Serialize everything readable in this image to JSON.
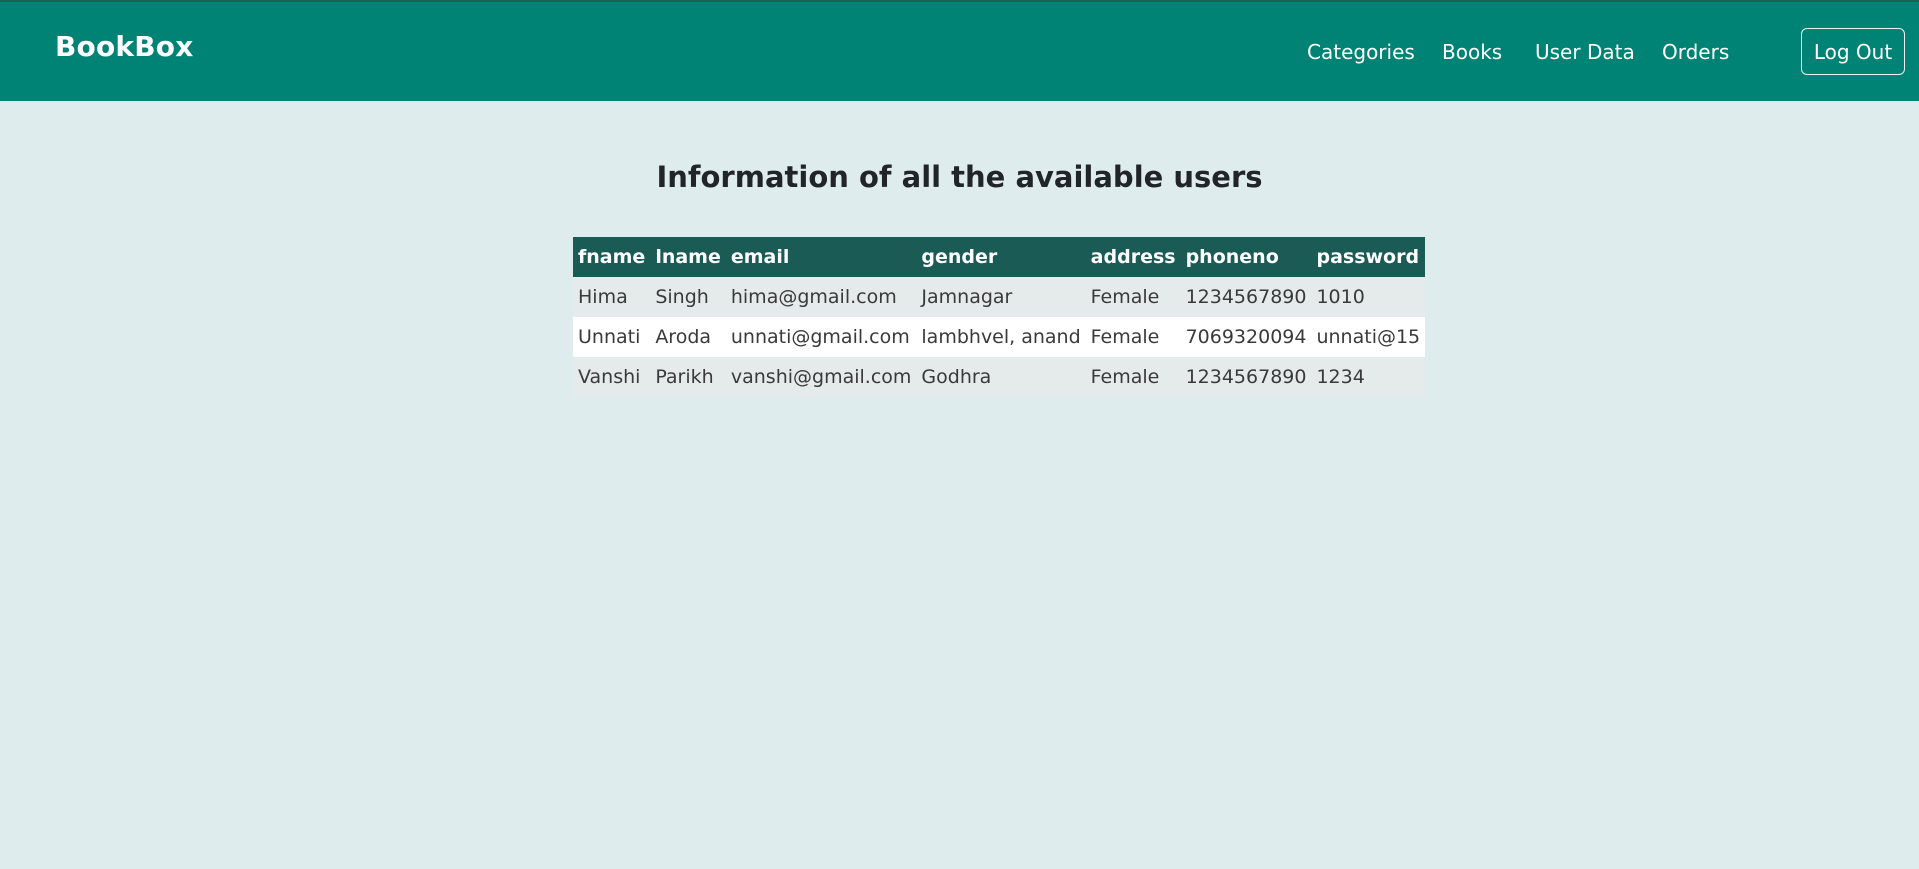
{
  "header": {
    "brand": "BookBox",
    "nav": [
      "Categories",
      "Books",
      "User Data",
      "Orders"
    ],
    "logout_label": "Log Out"
  },
  "main": {
    "title": "Information of all the available users",
    "table": {
      "columns": [
        "fname",
        "lname",
        "email",
        "gender",
        "address",
        "phoneno",
        "password"
      ],
      "rows": [
        [
          "Hima",
          "Singh",
          "hima@gmail.com",
          "Jamnagar",
          "Female",
          "1234567890",
          "1010"
        ],
        [
          "Unnati",
          "Aroda",
          "unnati@gmail.com",
          "lambhvel, anand",
          "Female",
          "7069320094",
          "unnati@15"
        ],
        [
          "Vanshi",
          "Parikh",
          "vanshi@gmail.com",
          "Godhra",
          "Female",
          "1234567890",
          "1234"
        ]
      ]
    }
  },
  "colors": {
    "navbar": "#008275",
    "table_header": "#1b5b55",
    "page_background": "#dfeced"
  }
}
